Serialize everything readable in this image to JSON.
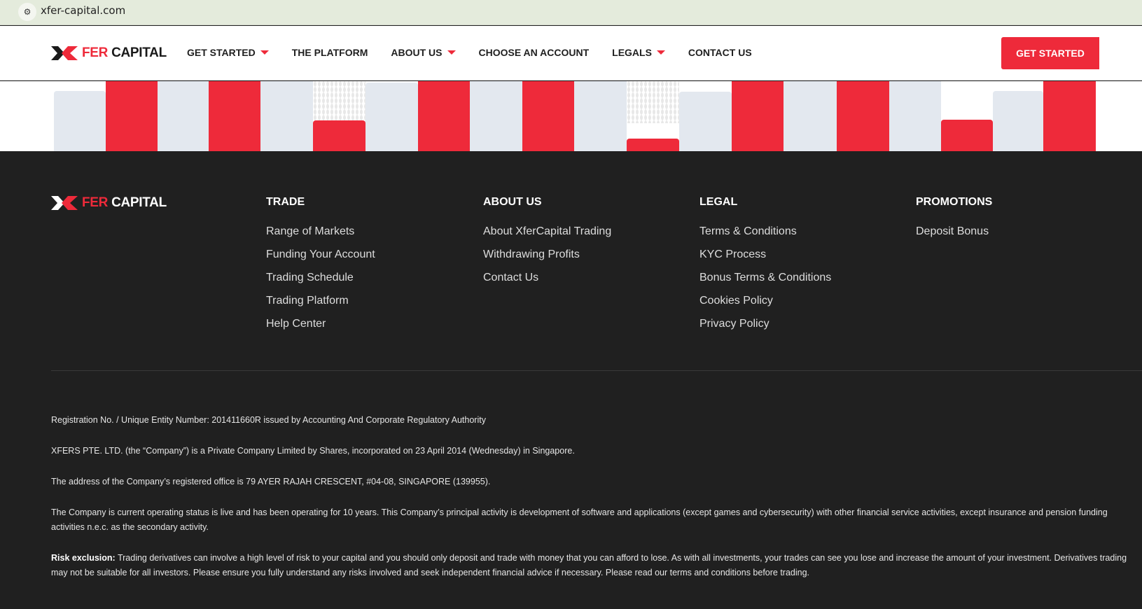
{
  "browser": {
    "url": "xfer-capital.com",
    "site_info_icon": "tune-icon"
  },
  "brand": {
    "part1": "FER",
    "part2": "CAPITAL",
    "logo_text": "XFER CAPITAL"
  },
  "nav": {
    "items": [
      {
        "label": "GET STARTED",
        "dropdown": true
      },
      {
        "label": "THE PLATFORM",
        "dropdown": false
      },
      {
        "label": "ABOUT US",
        "dropdown": true
      },
      {
        "label": "CHOOSE AN ACCOUNT",
        "dropdown": false
      },
      {
        "label": "LEGALS",
        "dropdown": true
      },
      {
        "label": "CONTACT US",
        "dropdown": false
      }
    ],
    "cta": "GET STARTED"
  },
  "colors": {
    "accent": "#ee2a3a",
    "footer_bg": "#202020",
    "bar_gray": "#e3e8ef"
  },
  "footer": {
    "columns": [
      {
        "title": "TRADE",
        "links": [
          "Range of Markets",
          "Funding Your Account",
          "Trading Schedule",
          "Trading Platform",
          "Help Center"
        ]
      },
      {
        "title": "ABOUT US",
        "links": [
          "About XferCapital Trading",
          "Withdrawing Profits",
          "Contact Us"
        ]
      },
      {
        "title": "LEGAL",
        "links": [
          "Terms & Conditions",
          "KYC Process",
          "Bonus Terms & Conditions",
          "Cookies Policy",
          "Privacy Policy"
        ]
      },
      {
        "title": "PROMOTIONS",
        "links": [
          "Deposit Bonus"
        ]
      }
    ],
    "legal": {
      "registration": "Registration No. / Unique Entity Number: 201411660R issued by Accounting And Corporate Regulatory Authority",
      "company": "XFERS PTE. LTD. (the “Company”) is a Private Company Limited by Shares, incorporated on 23 April 2014 (Wednesday) in Singapore.",
      "address": "The address of the Company’s registered office is 79 AYER RAJAH CRESCENT, #04-08, SINGAPORE (139955).",
      "status": "The Company is current operating status is live and has been operating for 10 years. This Company’s principal activity is development of software and applications (except games and cybersecurity) with other financial service activities, except insurance and pension funding activities n.e.c. as the secondary activity.",
      "risk_label": "Risk exclusion:",
      "risk_text": " Trading derivatives can involve a high level of risk to your capital and you should only deposit and trade with money that you can afford to lose. As with all investments, your trades can see you lose and increase the amount of your investment. Derivatives trading may not be suitable for all investors. Please ensure you fully understand any risks involved and seek independent financial advice if necessary. Please read our terms and conditions before trading."
    }
  }
}
